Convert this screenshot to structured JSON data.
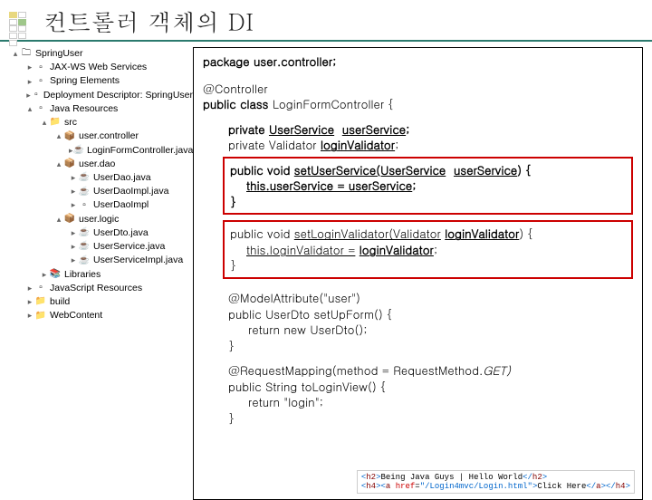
{
  "title": "컨트롤러 객체의 DI",
  "tree": {
    "project": "SpringUser",
    "items": [
      {
        "label": "JAX-WS Web Services",
        "lvl": 2,
        "ic": "▸"
      },
      {
        "label": "Spring Elements",
        "lvl": 2,
        "ic": "▸"
      },
      {
        "label": "Deployment Descriptor: SpringUser",
        "lvl": 2,
        "ic": "▸"
      },
      {
        "label": "Java Resources",
        "lvl": 2,
        "ic": "▴"
      },
      {
        "label": "src",
        "lvl": 3,
        "ic": "▴"
      },
      {
        "label": "user.controller",
        "lvl": 4,
        "ic": "▴"
      },
      {
        "label": "LoginFormController.java",
        "lvl": 5,
        "ic": "▸"
      },
      {
        "label": "user.dao",
        "lvl": 4,
        "ic": "▴"
      },
      {
        "label": "UserDao.java",
        "lvl": 5,
        "ic": "▸"
      },
      {
        "label": "UserDaoImpl.java",
        "lvl": 5,
        "ic": "▸"
      },
      {
        "label": "UserDaoImpl",
        "lvl": 5,
        "ic": "▸"
      },
      {
        "label": "user.logic",
        "lvl": 4,
        "ic": "▴"
      },
      {
        "label": "UserDto.java",
        "lvl": 5,
        "ic": "▸"
      },
      {
        "label": "UserService.java",
        "lvl": 5,
        "ic": "▸"
      },
      {
        "label": "UserServiceImpl.java",
        "lvl": 5,
        "ic": "▸"
      },
      {
        "label": "Libraries",
        "lvl": 3,
        "ic": "▸"
      },
      {
        "label": "JavaScript Resources",
        "lvl": 2,
        "ic": "▸"
      },
      {
        "label": "build",
        "lvl": 2,
        "ic": "▸"
      },
      {
        "label": "WebContent",
        "lvl": 2,
        "ic": "▸"
      }
    ]
  },
  "code": {
    "pkg": "package user.controller;",
    "ann": "@Controller",
    "clsDecl1": "public class",
    "clsDecl2": "LoginFormController {",
    "fld1a": "private",
    "fld1b": "UserService",
    "fld1c": "userService",
    "fld1d": ";",
    "fld2a": "private Validator",
    "fld2b": "loginValidator",
    "fld2c": ";",
    "m1l1a": "public void",
    "m1l1b": "setUserService(UserService",
    "m1l1c": "userService",
    "m1l1d": ") {",
    "m1l2a": "this.userService = userService",
    "m1l2b": ";",
    "m1l3": "}",
    "m2l1a": "public void",
    "m2l1b": "setLoginValidator(Validator",
    "m2l1c": "loginValidator",
    "m2l1d": ") {",
    "m2l2a": "this.loginValidator =",
    "m2l2b": "loginValidator",
    "m2l2c": ";",
    "m2l3": "}",
    "m3l1": "@ModelAttribute(\"user\")",
    "m3l2": "public UserDto setUpForm() {",
    "m3l3": "return new UserDto();",
    "m3l4": "}",
    "m4l1a": "@RequestMapping(method = RequestMethod.",
    "m4l1b": "GET)",
    "m4l2": "public String toLoginView() {",
    "m4l3": "return \"login\";",
    "m4l4": "}"
  },
  "snippet": {
    "l1": "<h2>Being Java Guys | Hello World</h2>",
    "l2": "<h4><a href=\"/Login4mvc/Login.html\">Click Here</a></h4>"
  }
}
